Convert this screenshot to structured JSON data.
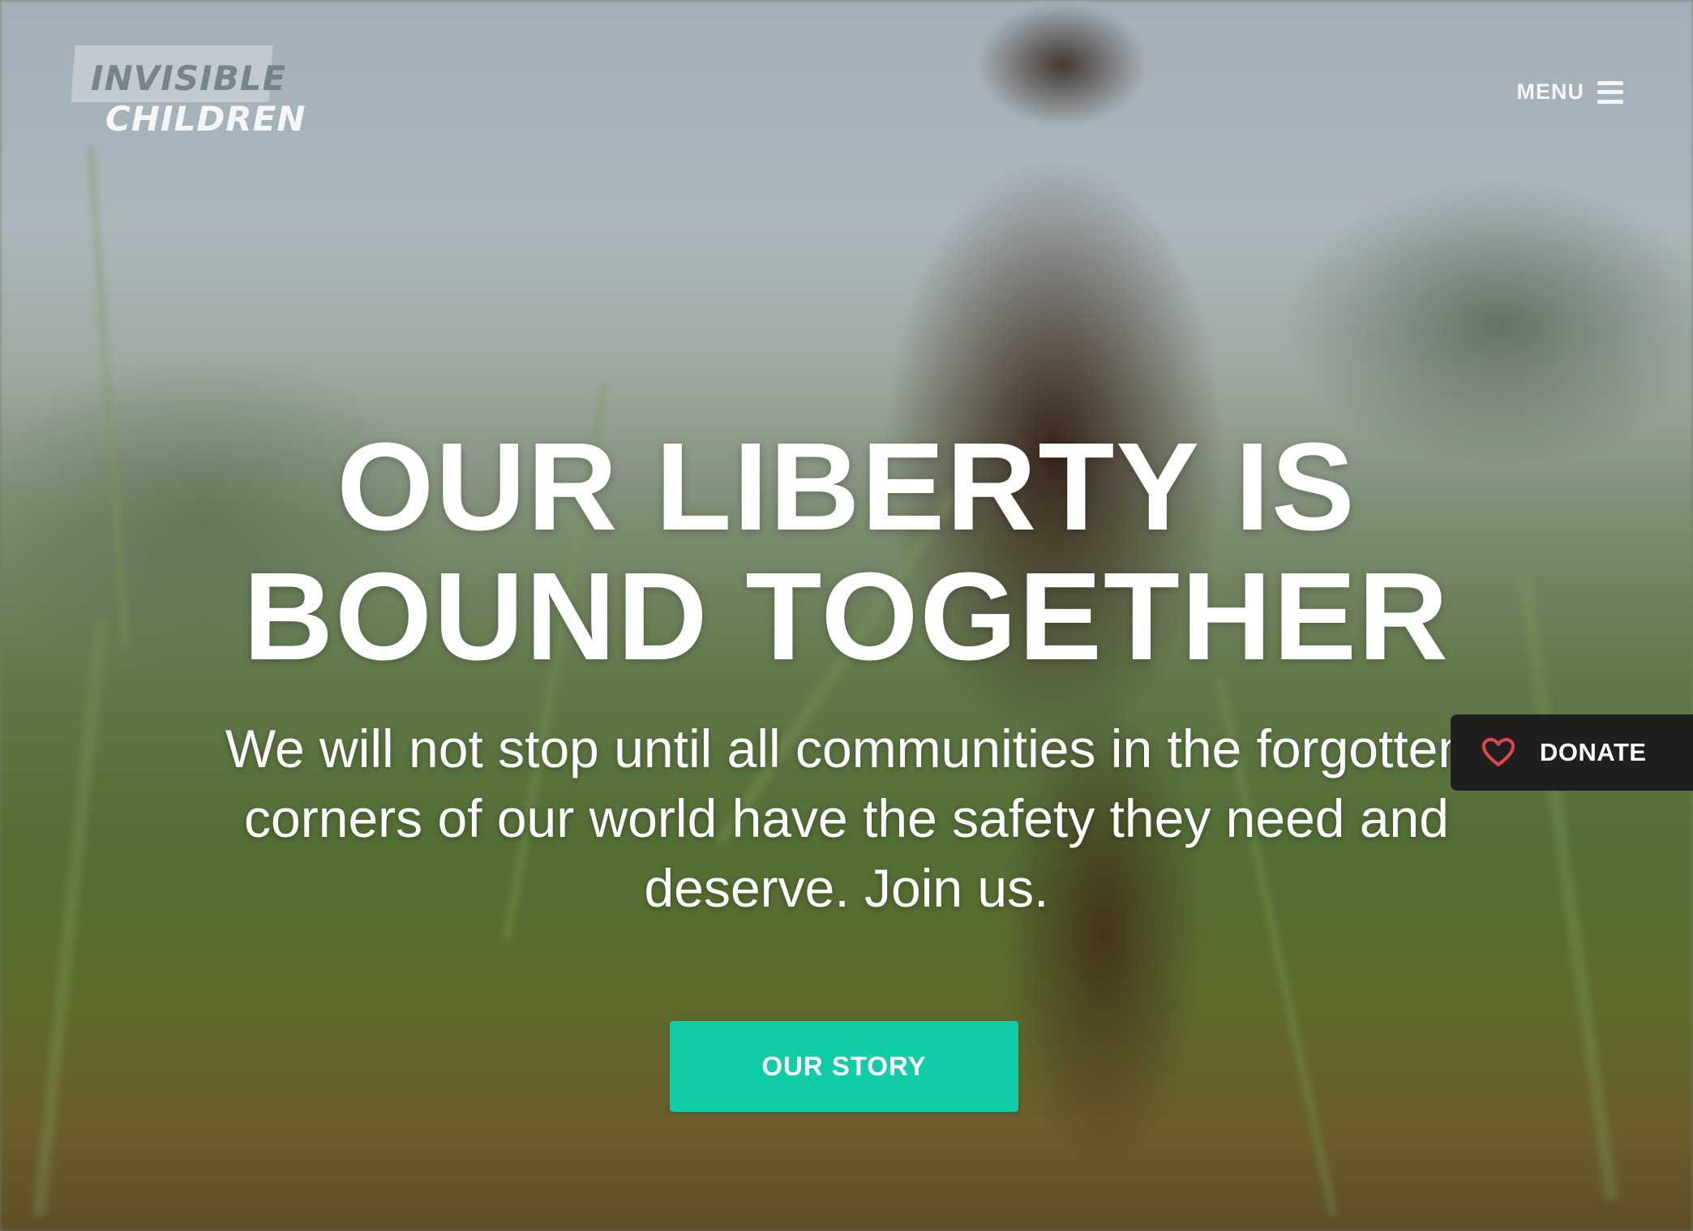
{
  "brand": {
    "logo_line1": "INVISIBLE",
    "logo_line2": "CHILDREN"
  },
  "nav": {
    "menu_label": "MENU",
    "menu_icon": "hamburger-icon"
  },
  "hero": {
    "headline_line1": "OUR LIBERTY IS",
    "headline_line2": "BOUND TOGETHER",
    "subtext": "We will not stop until all communities in the forgotten corners of our world have the safety they need and deserve. Join us.",
    "cta_label": "OUR STORY"
  },
  "donate": {
    "label": "DONATE",
    "icon": "heart-icon"
  },
  "colors": {
    "cta_bg": "#10cda7",
    "donate_bg": "#1f1f1f",
    "heart": "#e0474c",
    "text": "#ffffff"
  }
}
